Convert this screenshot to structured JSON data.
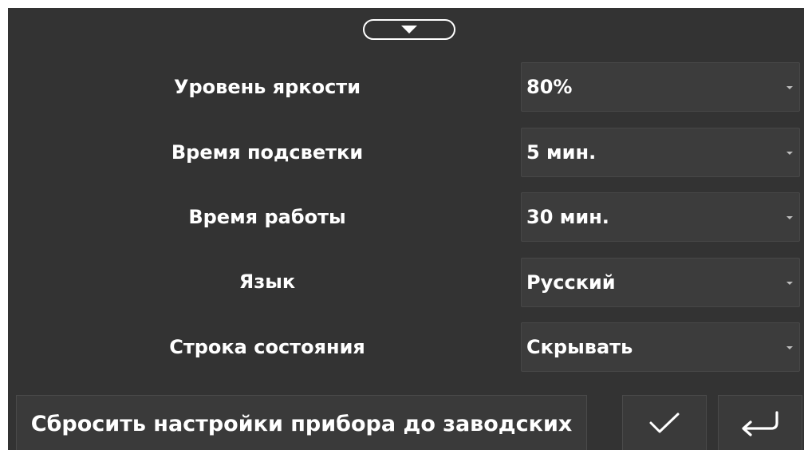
{
  "settings": [
    {
      "label": "Уровень яркости",
      "value": "80%"
    },
    {
      "label": "Время подсветки",
      "value": "5 мин."
    },
    {
      "label": "Время работы",
      "value": "30 мин."
    },
    {
      "label": "Язык",
      "value": "Русский"
    },
    {
      "label": "Строка состояния",
      "value": "Скрывать"
    }
  ],
  "footer": {
    "reset_label": "Сбросить настройки прибора до заводских",
    "confirm_icon": "checkmark-icon",
    "back_icon": "return-arrow-icon"
  },
  "header": {
    "collapse_icon": "triangle-down-icon"
  },
  "colors": {
    "background": "#333333",
    "control": "#3c3c3c",
    "text": "#ffffff"
  }
}
